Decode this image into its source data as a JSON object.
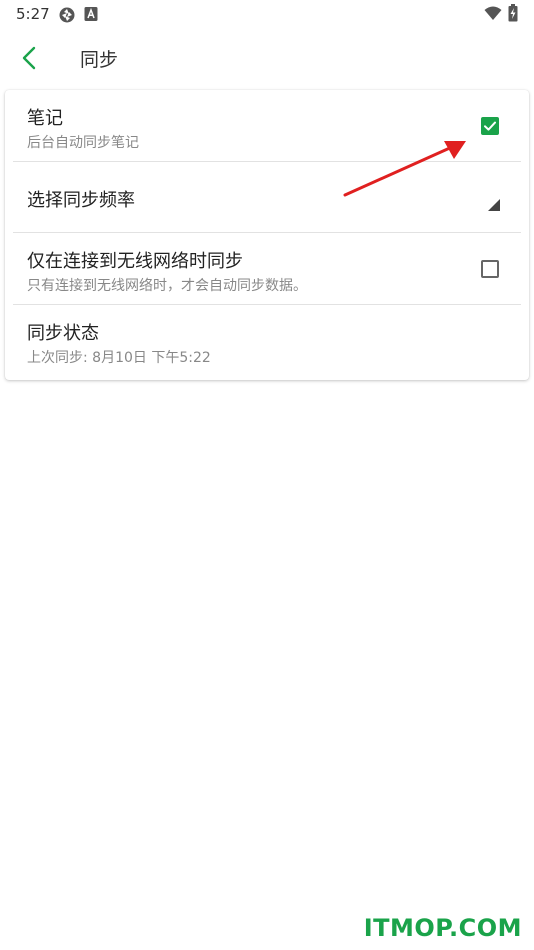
{
  "status_bar": {
    "time": "5:27"
  },
  "header": {
    "title": "同步"
  },
  "settings": {
    "notes": {
      "title": "笔记",
      "subtitle": "后台自动同步笔记",
      "checked": true
    },
    "frequency": {
      "title": "选择同步频率"
    },
    "wifi_only": {
      "title": "仅在连接到无线网络时同步",
      "subtitle": "只有连接到无线网络时，才会自动同步数据。",
      "checked": false
    },
    "sync_status": {
      "title": "同步状态",
      "subtitle": "上次同步: 8月10日 下午5:22"
    }
  },
  "watermark": "ITMOP.COM",
  "colors": {
    "accent": "#1aa34a",
    "annotation_arrow": "#e02020"
  },
  "icons": {
    "back": "chevron-left-icon",
    "wifi": "wifi-icon",
    "battery": "battery-charging-icon"
  }
}
